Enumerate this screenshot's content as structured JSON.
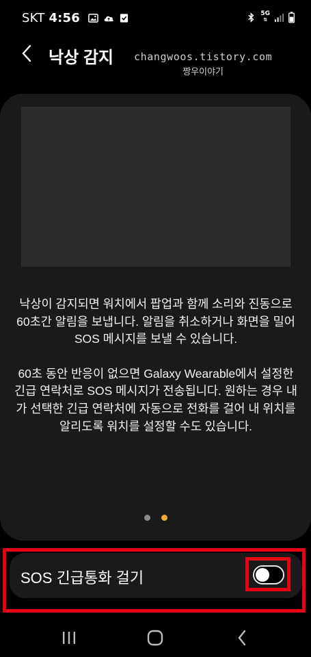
{
  "status_bar": {
    "carrier": "SKT",
    "time": "4:56",
    "network": "5G"
  },
  "header": {
    "title": "낙상 감지",
    "watermark_url": "changwoos.tistory.com",
    "watermark_name": "짱우이야기"
  },
  "card": {
    "paragraph1": "낙상이 감지되면 워치에서 팝업과 함께 소리와 진동으로 60초간 알림을 보냅니다. 알림을 취소하거나 화면을 밀어 SOS 메시지를 보낼 수 있습니다.",
    "paragraph2": "60초 동안 반응이 없으면 Galaxy Wearable에서 설정한 긴급 연락처로 SOS 메시지가 전송됩니다. 원하는 경우 내가 선택한 긴급 연락처에 자동으로 전화를 걸어 내 위치를 알리도록 워치를 설정할 수도 있습니다.",
    "page_indicator": {
      "total": 2,
      "current": 2
    }
  },
  "sos_setting": {
    "label": "SOS 긴급통화 걸기",
    "enabled": false
  },
  "colors": {
    "background": "#000000",
    "card": "#1a1a1a",
    "highlight": "#e60012",
    "active_dot": "#f0a836"
  },
  "icons": [
    "gallery-icon",
    "cloud-icon",
    "check-icon",
    "bluetooth-icon",
    "network-icon",
    "signal-icon",
    "battery-icon",
    "back-arrow-icon",
    "recents-icon",
    "home-icon",
    "back-nav-icon"
  ]
}
